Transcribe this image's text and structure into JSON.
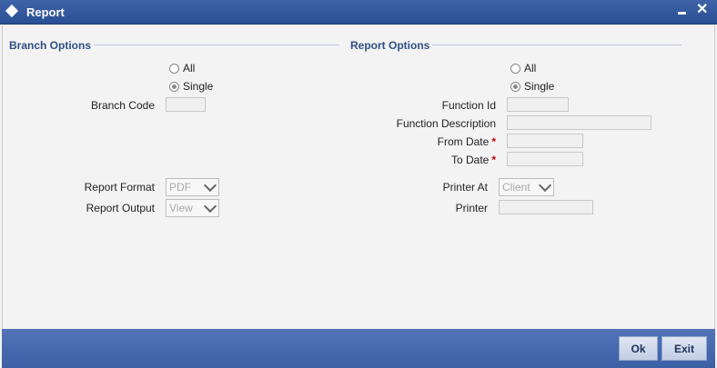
{
  "window": {
    "title": "Report"
  },
  "branch_options": {
    "title": "Branch Options",
    "radio_all": "All",
    "radio_single": "Single",
    "selected": "Single",
    "branch_code_label": "Branch Code",
    "branch_code_value": ""
  },
  "report_options": {
    "title": "Report Options",
    "radio_all": "All",
    "radio_single": "Single",
    "selected": "Single",
    "function_id_label": "Function Id",
    "function_description_label": "Function Description",
    "from_date_label": "From Date",
    "to_date_label": "To Date",
    "required_mark": "*"
  },
  "output": {
    "report_format_label": "Report Format",
    "report_format_value": "PDF",
    "report_output_label": "Report Output",
    "report_output_value": "View",
    "printer_at_label": "Printer At",
    "printer_at_value": "Client",
    "printer_label": "Printer"
  },
  "footer": {
    "ok_label": "Ok",
    "exit_label": "Exit"
  }
}
